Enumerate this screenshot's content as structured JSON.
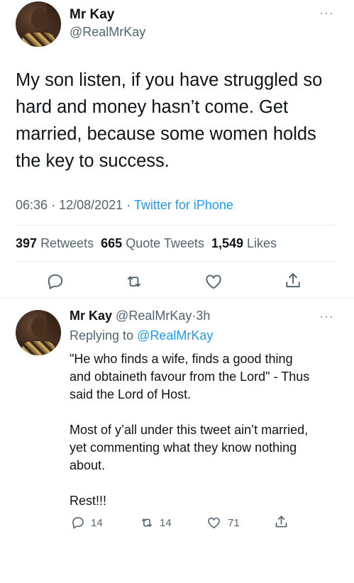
{
  "main_tweet": {
    "author_name": "Mr Kay",
    "author_handle": "@RealMrKay",
    "more_label": "···",
    "text_lines": [
      "My son listen, if you have struggled so",
      "hard and money hasn’t come. Get",
      "married, because some women holds",
      "the key to success."
    ],
    "time": "06:36",
    "date": "12/08/2021",
    "separator": "·",
    "source": "Twitter for iPhone",
    "stats": {
      "retweets_count": "397",
      "retweets_label": "Retweets",
      "quotes_count": "665",
      "quotes_label": "Quote Tweets",
      "likes_count": "1,549",
      "likes_label": "Likes"
    },
    "actions": [
      "reply-icon",
      "retweet-icon",
      "like-icon",
      "share-icon"
    ]
  },
  "reply_tweet": {
    "author_name": "Mr Kay",
    "author_handle": "@RealMrKay",
    "age": "3h",
    "separator": "·",
    "more_label": "···",
    "replying_prefix": "Replying to",
    "replying_handle": "@RealMrKay",
    "text_lines": [
      "\"He who finds a wife, finds a good thing",
      "and obtaineth favour from the Lord\" - Thus",
      "said the Lord of Host.",
      "",
      "Most of y’all under this tweet ain’t married,",
      "yet commenting what they know nothing",
      "about.",
      "",
      "Rest!!!"
    ],
    "counts": {
      "replies": "14",
      "retweets": "14",
      "likes": "71"
    }
  },
  "colors": {
    "accent": "#1d9bf0",
    "secondary_text": "#536471",
    "divider": "#e6ecf0"
  }
}
